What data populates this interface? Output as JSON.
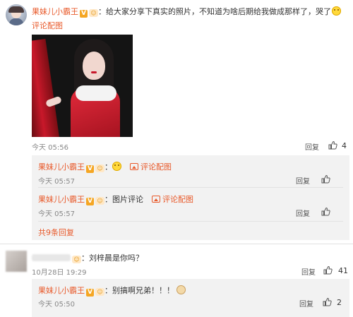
{
  "main_post": {
    "username": "果妹儿小霸王",
    "verified_badge": "V",
    "level_badge": "☺",
    "colon": "：",
    "text": "给大家分享下真实的照片，不知道为啥后期给我做成那样了，哭了",
    "comment_pic_label": "评论配图",
    "time": "今天 05:56",
    "reply_label": "回复",
    "like_count": "4"
  },
  "sub_replies": [
    {
      "username": "果妹儿小霸王",
      "verified_badge": "V",
      "colon": "：",
      "pic_label": "评论配图",
      "time": "今天 05:57",
      "reply_label": "回复",
      "like_count": ""
    },
    {
      "username": "果妹儿小霸王",
      "verified_badge": "V",
      "colon": "：",
      "text": "图片评论",
      "pic_label": "评论配图",
      "time": "今天 05:57",
      "reply_label": "回复",
      "like_count": ""
    }
  ],
  "more_replies_label": "共9条回复",
  "second_post": {
    "colon": "：",
    "text": "刘梓晨是你吗？",
    "time": "10月28日 19:29",
    "reply_label": "回复",
    "like_count": "41"
  },
  "second_reply": {
    "username": "果妹儿小霸王",
    "verified_badge": "V",
    "colon": "：",
    "text": "别搞啊兄弟！！！",
    "time": "今天 05:50",
    "reply_label": "回复",
    "like_count": "2"
  },
  "colors": {
    "username": "#e8592a",
    "sub_panel_bg": "#f2f2f2",
    "badge_gold": "#f5a623"
  }
}
